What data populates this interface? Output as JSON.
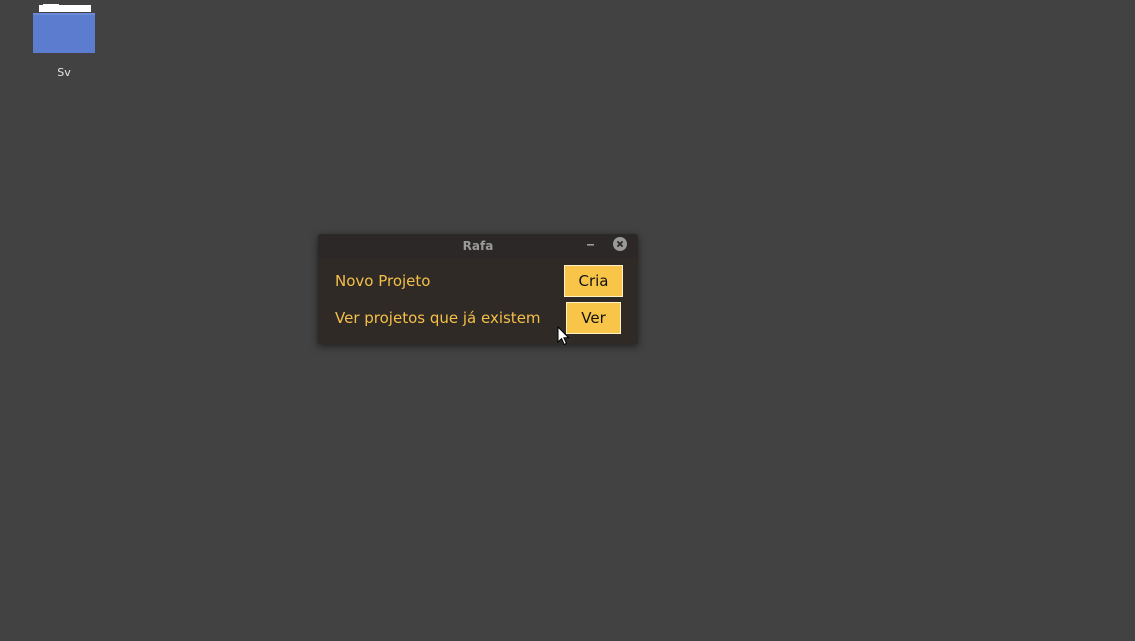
{
  "desktop": {
    "background": "#424242",
    "icons": [
      {
        "label": "Sv",
        "icon": "folder-icon",
        "color": "#5b7ccf"
      }
    ]
  },
  "window": {
    "title": "Rafa",
    "controls": [
      "minimize-icon",
      "close-icon"
    ],
    "accent": "#f8c549",
    "rows": [
      {
        "label": "Novo Projeto",
        "button": "Cria"
      },
      {
        "label": "Ver projetos que já existem",
        "button": "Ver"
      }
    ]
  }
}
